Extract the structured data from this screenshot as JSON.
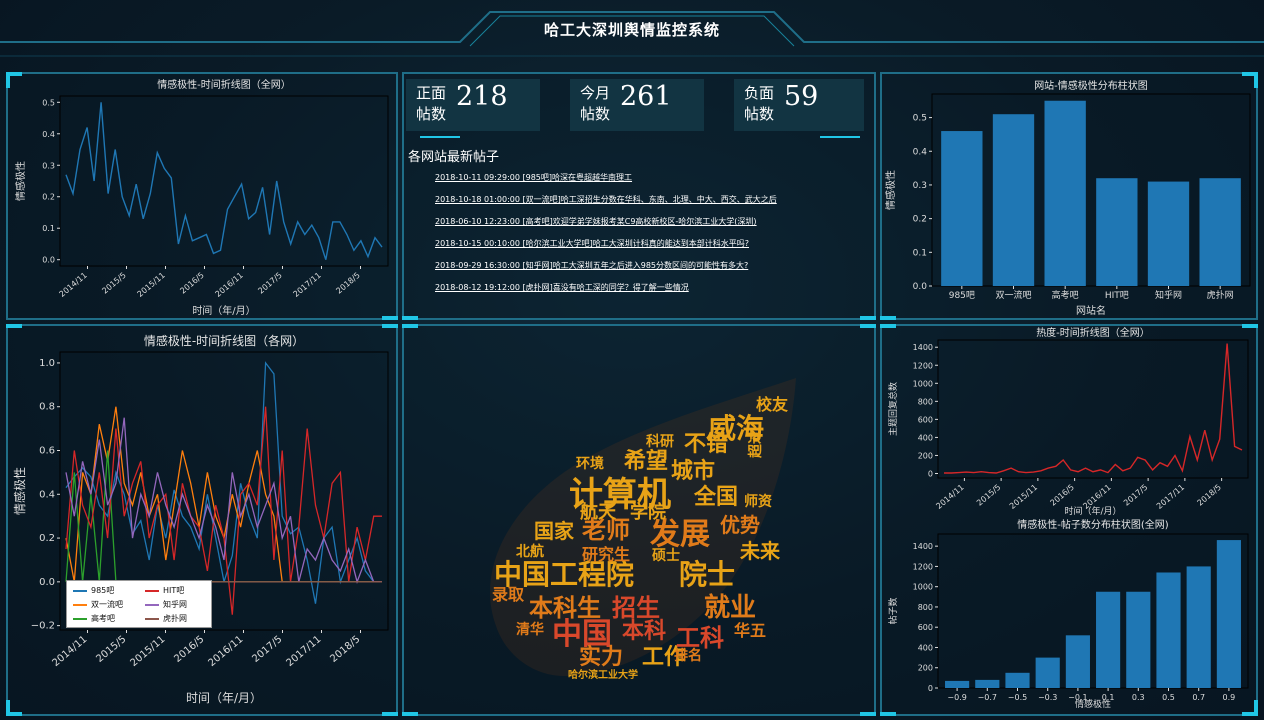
{
  "app": {
    "title": "哈工大深圳舆情监控系统"
  },
  "stats": [
    {
      "label_line1": "正面",
      "label_line2": "帖数",
      "value": "218"
    },
    {
      "label_line1": "今月",
      "label_line2": "帖数",
      "value": "261"
    },
    {
      "label_line1": "负面",
      "label_line2": "帖数",
      "value": "59"
    }
  ],
  "news": {
    "heading": "各网站最新帖子",
    "items": [
      "2018-10-11 09:29:00 [985吧]哈深在粤超越华南理工",
      "2018-10-18 01:00:00 [双一流吧]哈工深招生分数在华科、东南、北理、中大、西交、武大之后",
      "2018-06-10 12:23:00 [高考吧]欢迎学弟学妹报考某C9高校新校区-哈尔滨工业大学(深圳)",
      "2018-10-15 00:10:00 [哈尔滨工业大学吧]哈工大深圳计科真的能达到本部计科水平吗?",
      "2018-09-29 16:30:00 [知乎网]哈工大深圳五年之后进入985分数区间的可能性有多大?",
      "2018-08-12 19:12:00 [虎扑网]喜没有哈工深的同学？得了解一些情况"
    ]
  },
  "colors": {
    "accent": "#20c6e6",
    "panel_border": "#1f6e88",
    "bar": "#1f77b4",
    "heat_line": "#d62728",
    "word_gold": "#e8a317",
    "word_orange": "#e07b1a",
    "word_red": "#d9482b"
  },
  "charts": [
    {
      "type": "line",
      "title": "情感极性-时间折线图（全网）",
      "xlabel": "时间（年/月）",
      "ylabel": "情感极性",
      "ylim": [
        -0.02,
        0.52
      ],
      "yticks": [
        "0.0",
        "0.1",
        "0.2",
        "0.3",
        "0.4",
        "0.5"
      ],
      "xticks": [
        "2014/11",
        "2015/5",
        "2015/11",
        "2016/5",
        "2016/11",
        "2017/5",
        "2017/11",
        "2018/5"
      ],
      "series": [
        {
          "values": [
            0.27,
            0.21,
            0.35,
            0.42,
            0.25,
            0.5,
            0.21,
            0.35,
            0.2,
            0.14,
            0.24,
            0.13,
            0.21,
            0.34,
            0.29,
            0.26,
            0.05,
            0.14,
            0.06,
            0.07,
            0.08,
            0.02,
            0.03,
            0.16,
            0.2,
            0.24,
            0.13,
            0.15,
            0.23,
            0.08,
            0.25,
            0.12,
            0.05,
            0.12,
            0.08,
            0.11,
            0.07,
            0.0,
            0.12,
            0.12,
            0.08,
            0.03,
            0.06,
            0.01,
            0.07,
            0.04
          ]
        }
      ]
    },
    {
      "type": "bar",
      "title": "网站-情感极性分布柱状图",
      "xlabel": "网站名",
      "ylabel": "情感极性",
      "ylim": [
        0,
        0.57
      ],
      "yticks": [
        "0.0",
        "0.1",
        "0.2",
        "0.3",
        "0.4",
        "0.5"
      ],
      "categories": [
        "985吧",
        "双一流吧",
        "高考吧",
        "HIT吧",
        "知乎网",
        "虎扑网"
      ],
      "values": [
        0.46,
        0.51,
        0.55,
        0.32,
        0.31,
        0.32
      ]
    },
    {
      "type": "line",
      "title": "情感极性-时间折线图（各网）",
      "xlabel": "时间（年/月）",
      "ylabel": "情感极性",
      "ylim": [
        -0.22,
        1.05
      ],
      "yticks": [
        "−0.2",
        "0.0",
        "0.2",
        "0.4",
        "0.6",
        "0.8",
        "1.0"
      ],
      "xticks": [
        "2014/11",
        "2015/5",
        "2015/11",
        "2016/5",
        "2016/11",
        "2017/5",
        "2017/11",
        "2018/5"
      ],
      "series": [
        {
          "name": "985吧",
          "values": [
            0.43,
            0.48,
            0.52,
            0.48,
            0.35,
            0.3,
            0.5,
            0.4,
            0.22,
            0.28,
            0.1,
            0.35,
            0.2,
            0.42,
            0.3,
            0.25,
            0.15,
            0.4,
            0.2,
            0.0,
            0.12,
            0.45,
            0.3,
            0.2,
            1.0,
            0.95,
            0.3,
            0.22,
            0.25,
            0.1,
            -0.1,
            0.2,
            0.25,
            0.0,
            0.1,
            0.2,
            0.05,
            0.0,
            0.0
          ]
        },
        {
          "name": "双一流吧",
          "values": [
            0.2,
            0.0,
            0.5,
            0.4,
            0.72,
            0.55,
            0.8,
            0.45,
            0.35,
            0.5,
            0.3,
            0.4,
            0.1,
            0.35,
            0.6,
            0.45,
            0.25,
            0.5,
            0.3,
            0.2,
            0.4,
            0.25,
            0.45,
            0.6,
            0.4,
            0.3,
            0.0,
            0.0,
            0.0,
            0.0,
            0.0,
            0.0,
            0.0,
            0.0,
            0.0,
            0.0,
            0.0,
            0.0,
            0.0
          ]
        },
        {
          "name": "高考吧",
          "values": [
            0.0,
            0.5,
            0.0,
            0.4,
            0.0,
            0.6,
            0.0,
            0.0,
            0.0,
            0.0,
            0.0,
            0.0,
            0.0,
            0.0,
            0.0,
            0.0,
            0.0,
            0.0,
            0.0,
            0.0,
            0.0,
            0.0,
            0.0,
            0.0,
            0.0,
            0.0,
            0.0,
            0.0,
            0.0,
            0.0,
            0.0,
            0.0,
            0.0,
            0.0,
            0.0,
            0.0,
            0.0,
            0.0,
            0.0
          ]
        },
        {
          "name": "HIT吧",
          "values": [
            0.15,
            0.6,
            0.35,
            0.25,
            0.5,
            0.2,
            0.7,
            0.3,
            0.45,
            0.55,
            0.2,
            0.35,
            0.4,
            0.1,
            0.45,
            0.3,
            0.25,
            0.05,
            0.35,
            0.2,
            -0.15,
            0.4,
            0.45,
            0.35,
            0.8,
            0.1,
            0.6,
            0.0,
            0.25,
            0.7,
            0.35,
            0.2,
            0.45,
            0.5,
            0.0,
            0.25,
            0.1,
            0.3,
            0.3
          ]
        },
        {
          "name": "知乎网",
          "values": [
            0.5,
            0.3,
            0.55,
            0.4,
            0.65,
            0.35,
            0.45,
            0.75,
            0.2,
            0.4,
            0.3,
            0.5,
            0.35,
            0.25,
            0.4,
            0.3,
            0.2,
            0.35,
            0.25,
            0.1,
            0.5,
            0.3,
            0.4,
            0.25,
            0.35,
            0.45,
            0.2,
            0.3,
            0.0,
            0.15,
            0.1,
            0.2,
            0.1,
            0.05,
            0.15,
            0.0,
            0.1,
            0.0,
            0.0
          ]
        },
        {
          "name": "虎扑网",
          "values": [
            0.0,
            0.0,
            0.0,
            0.0,
            0.0,
            0.0,
            0.0,
            0.0,
            0.0,
            0.0,
            0.0,
            0.0,
            0.0,
            0.0,
            0.0,
            0.0,
            0.0,
            0.0,
            0.0,
            0.0,
            0.0,
            0.0,
            0.0,
            0.0,
            0.0,
            0.0,
            0.0,
            0.0,
            0.0,
            0.0,
            0.0,
            0.0,
            0.0,
            0.0,
            0.0,
            0.0,
            0.0,
            0.0,
            0.0
          ]
        }
      ]
    },
    {
      "type": "line",
      "title": "热度-时间折线图（全网）",
      "xlabel": "时间（年/月）",
      "ylabel": "主题回复总数",
      "ylim": [
        -50,
        1480
      ],
      "yticks": [
        "0",
        "200",
        "400",
        "600",
        "800",
        "1000",
        "1200",
        "1400"
      ],
      "xticks": [
        "2014/11",
        "2015/5",
        "2015/11",
        "2016/5",
        "2016/11",
        "2017/5",
        "2017/11",
        "2018/5"
      ],
      "series": [
        {
          "values": [
            5,
            5,
            10,
            15,
            10,
            20,
            10,
            5,
            30,
            60,
            20,
            10,
            15,
            30,
            60,
            80,
            150,
            40,
            20,
            60,
            20,
            40,
            10,
            100,
            30,
            60,
            180,
            150,
            40,
            120,
            80,
            200,
            30,
            410,
            150,
            480,
            150,
            380,
            1440,
            300,
            260
          ]
        }
      ]
    },
    {
      "type": "bar",
      "title": "情感极性-帖子数分布柱状图(全网)",
      "xlabel": "情感极性",
      "ylabel": "帖子数",
      "ylim": [
        0,
        1520
      ],
      "yticks": [
        "0",
        "200",
        "400",
        "600",
        "800",
        "1000",
        "1200",
        "1400"
      ],
      "categories": [
        "−0.9",
        "−0.7",
        "−0.5",
        "−0.3",
        "−0.1",
        "0.1",
        "0.3",
        "0.5",
        "0.7",
        "0.9"
      ],
      "values": [
        70,
        80,
        150,
        300,
        520,
        950,
        950,
        1140,
        1200,
        1460
      ]
    }
  ],
  "wordcloud": {
    "words": [
      {
        "text": "中国工程院",
        "color": "#e8a317"
      },
      {
        "text": "院士",
        "color": "#e8a317"
      },
      {
        "text": "计算机",
        "color": "#e8a317"
      },
      {
        "text": "发展",
        "color": "#e07b1a"
      },
      {
        "text": "中国",
        "color": "#d9482b"
      },
      {
        "text": "本科生",
        "color": "#e07b1a"
      },
      {
        "text": "招生",
        "color": "#d9482b"
      },
      {
        "text": "就业",
        "color": "#e07b1a"
      },
      {
        "text": "实力",
        "color": "#e07b1a"
      },
      {
        "text": "工作",
        "color": "#e8a317"
      },
      {
        "text": "老师",
        "color": "#e07b1a"
      },
      {
        "text": "威海",
        "color": "#e8a317"
      },
      {
        "text": "城市",
        "color": "#e8a317"
      },
      {
        "text": "不错",
        "color": "#e8a317"
      },
      {
        "text": "全国",
        "color": "#e8a317"
      },
      {
        "text": "师资",
        "color": "#e8a317"
      },
      {
        "text": "优势",
        "color": "#e07b1a"
      },
      {
        "text": "未来",
        "color": "#e8a317"
      },
      {
        "text": "希望",
        "color": "#e8a317"
      },
      {
        "text": "本科",
        "color": "#d9482b"
      },
      {
        "text": "工科",
        "color": "#d9482b"
      },
      {
        "text": "国家",
        "color": "#e8a317"
      },
      {
        "text": "航天",
        "color": "#e8a317"
      },
      {
        "text": "学院",
        "color": "#e8a317"
      },
      {
        "text": "研究生",
        "color": "#e07b1a"
      },
      {
        "text": "北航",
        "color": "#e8a317"
      },
      {
        "text": "录取",
        "color": "#e07b1a"
      },
      {
        "text": "清华",
        "color": "#e07b1a"
      },
      {
        "text": "华五",
        "color": "#e07b1a"
      },
      {
        "text": "校友",
        "color": "#e8a317"
      },
      {
        "text": "科研",
        "color": "#e8a317"
      },
      {
        "text": "环境",
        "color": "#e8a317"
      },
      {
        "text": "超过",
        "color": "#e8a317"
      },
      {
        "text": "硕士",
        "color": "#e8a317"
      },
      {
        "text": "排名",
        "color": "#e07b1a"
      },
      {
        "text": "哈尔滨工业大学",
        "color": "#e8a317"
      }
    ]
  }
}
